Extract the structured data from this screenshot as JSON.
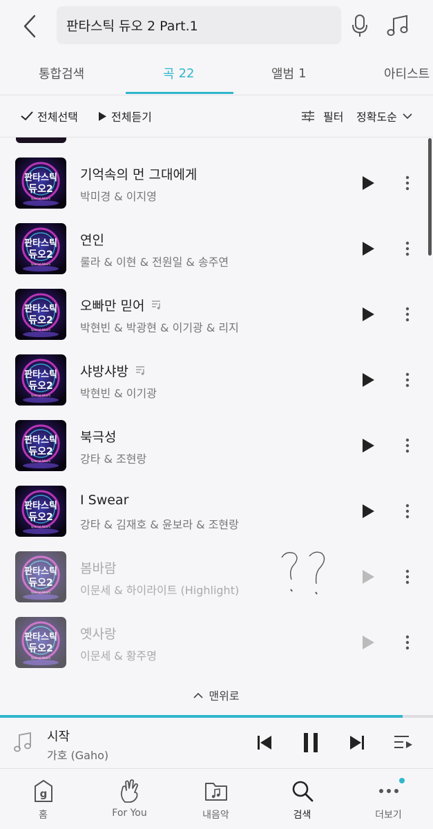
{
  "header": {
    "search_value": "판타스틱 듀오 2 Part.1",
    "icons": [
      "back-arrow-icon",
      "microphone-icon",
      "music-note-icon"
    ]
  },
  "tabs": [
    {
      "label": "통합검색",
      "count": "",
      "active": false
    },
    {
      "label": "곡",
      "count": "22",
      "active": true
    },
    {
      "label": "앨범",
      "count": "1",
      "active": false
    },
    {
      "label": "아티스트",
      "count": "",
      "active": false
    }
  ],
  "toolbar": {
    "select_all": "전체선택",
    "play_all": "전체듣기",
    "filter": "필터",
    "sort": "정확도순"
  },
  "album_art": {
    "line1": "판타스틱",
    "line2": "듀오2",
    "caption": "Special Album"
  },
  "songs": [
    {
      "title": "기억속의 먼 그대에게",
      "artist": "박미경 & 이지영",
      "lyrics_badge": false,
      "available": true
    },
    {
      "title": "연인",
      "artist": "룰라 & 이현 & 전원일 & 송주연",
      "lyrics_badge": false,
      "available": true
    },
    {
      "title": "오빠만 믿어",
      "artist": "박현빈 & 박광현 & 이기광 & 리지",
      "lyrics_badge": true,
      "available": true
    },
    {
      "title": "샤방샤방",
      "artist": "박현빈 & 이기광",
      "lyrics_badge": true,
      "available": true
    },
    {
      "title": "북극성",
      "artist": "강타 & 조현랑",
      "lyrics_badge": false,
      "available": true
    },
    {
      "title": "I Swear",
      "artist": "강타 & 김재호 & 윤보라 & 조현랑",
      "lyrics_badge": false,
      "available": true
    },
    {
      "title": "봄바람",
      "artist": "이문세 & 하이라이트 (Highlight)",
      "lyrics_badge": false,
      "available": false
    },
    {
      "title": "옛사랑",
      "artist": "이문세 & 황주명",
      "lyrics_badge": false,
      "available": false
    }
  ],
  "annotation": "??",
  "to_top": "맨위로",
  "player": {
    "title": "시작",
    "artist": "가호 (Gaho)",
    "progress": 0.93,
    "state": "playing"
  },
  "bottom_nav": [
    {
      "label": "홈",
      "icon": "home-g-icon",
      "active": false
    },
    {
      "label": "For You",
      "icon": "hand-icon",
      "active": false
    },
    {
      "label": "내음악",
      "icon": "folder-music-icon",
      "active": false
    },
    {
      "label": "검색",
      "icon": "search-icon",
      "active": true
    },
    {
      "label": "더보기",
      "icon": "more-dots-icon",
      "active": false,
      "badge": true
    }
  ],
  "colors": {
    "accent": "#2fb6cc",
    "background": "#f6f6f8"
  }
}
